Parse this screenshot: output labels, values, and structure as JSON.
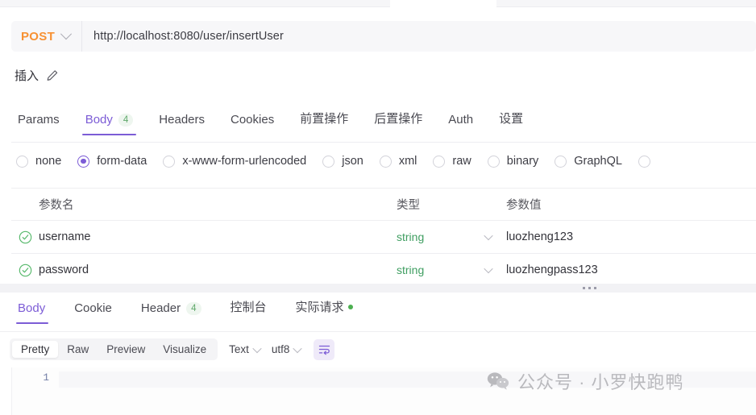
{
  "request": {
    "method": "POST",
    "method_icon": "chevron-down-icon",
    "url": "http://localhost:8080/user/insertUser",
    "name": "插入",
    "name_edit_icon": "pencil-icon"
  },
  "request_tabs": [
    {
      "label": "Params",
      "badge": "",
      "active": false
    },
    {
      "label": "Body",
      "badge": "4",
      "active": true
    },
    {
      "label": "Headers",
      "badge": "",
      "active": false
    },
    {
      "label": "Cookies",
      "badge": "",
      "active": false
    },
    {
      "label": "前置操作",
      "badge": "",
      "active": false
    },
    {
      "label": "后置操作",
      "badge": "",
      "active": false
    },
    {
      "label": "Auth",
      "badge": "",
      "active": false
    },
    {
      "label": "设置",
      "badge": "",
      "active": false
    }
  ],
  "body_types": [
    {
      "label": "none",
      "selected": false
    },
    {
      "label": "form-data",
      "selected": true
    },
    {
      "label": "x-www-form-urlencoded",
      "selected": false
    },
    {
      "label": "json",
      "selected": false
    },
    {
      "label": "xml",
      "selected": false
    },
    {
      "label": "raw",
      "selected": false
    },
    {
      "label": "binary",
      "selected": false
    },
    {
      "label": "GraphQL",
      "selected": false
    }
  ],
  "params_table": {
    "headers": {
      "name": "参数名",
      "type": "类型",
      "value": "参数值"
    },
    "rows": [
      {
        "enabled_icon": "check-circle-icon",
        "name": "username",
        "type": "string",
        "value": "luozheng123"
      },
      {
        "enabled_icon": "check-circle-icon",
        "name": "password",
        "type": "string",
        "value": "luozhengpass123"
      }
    ]
  },
  "response_tabs": [
    {
      "label": "Body",
      "badge": "",
      "dot": false,
      "active": true
    },
    {
      "label": "Cookie",
      "badge": "",
      "dot": false,
      "active": false
    },
    {
      "label": "Header",
      "badge": "4",
      "dot": false,
      "active": false
    },
    {
      "label": "控制台",
      "badge": "",
      "dot": false,
      "active": false
    },
    {
      "label": "实际请求",
      "badge": "",
      "dot": true,
      "active": false
    }
  ],
  "view_toolbar": {
    "modes": [
      {
        "label": "Pretty",
        "selected": true
      },
      {
        "label": "Raw",
        "selected": false
      },
      {
        "label": "Preview",
        "selected": false
      },
      {
        "label": "Visualize",
        "selected": false
      }
    ],
    "format": "Text",
    "encoding": "utf8",
    "wrap_icon": "text-wrap-icon"
  },
  "editor": {
    "line_numbers": [
      "1"
    ],
    "content": ""
  },
  "watermark": {
    "icon": "wechat-bubbles-icon",
    "text": "公众号 · 小罗快跑鸭"
  },
  "colors": {
    "accent": "#7c5cd6",
    "method": "#f79133",
    "success": "#3f9e61",
    "badge_text": "#5fa86a"
  }
}
